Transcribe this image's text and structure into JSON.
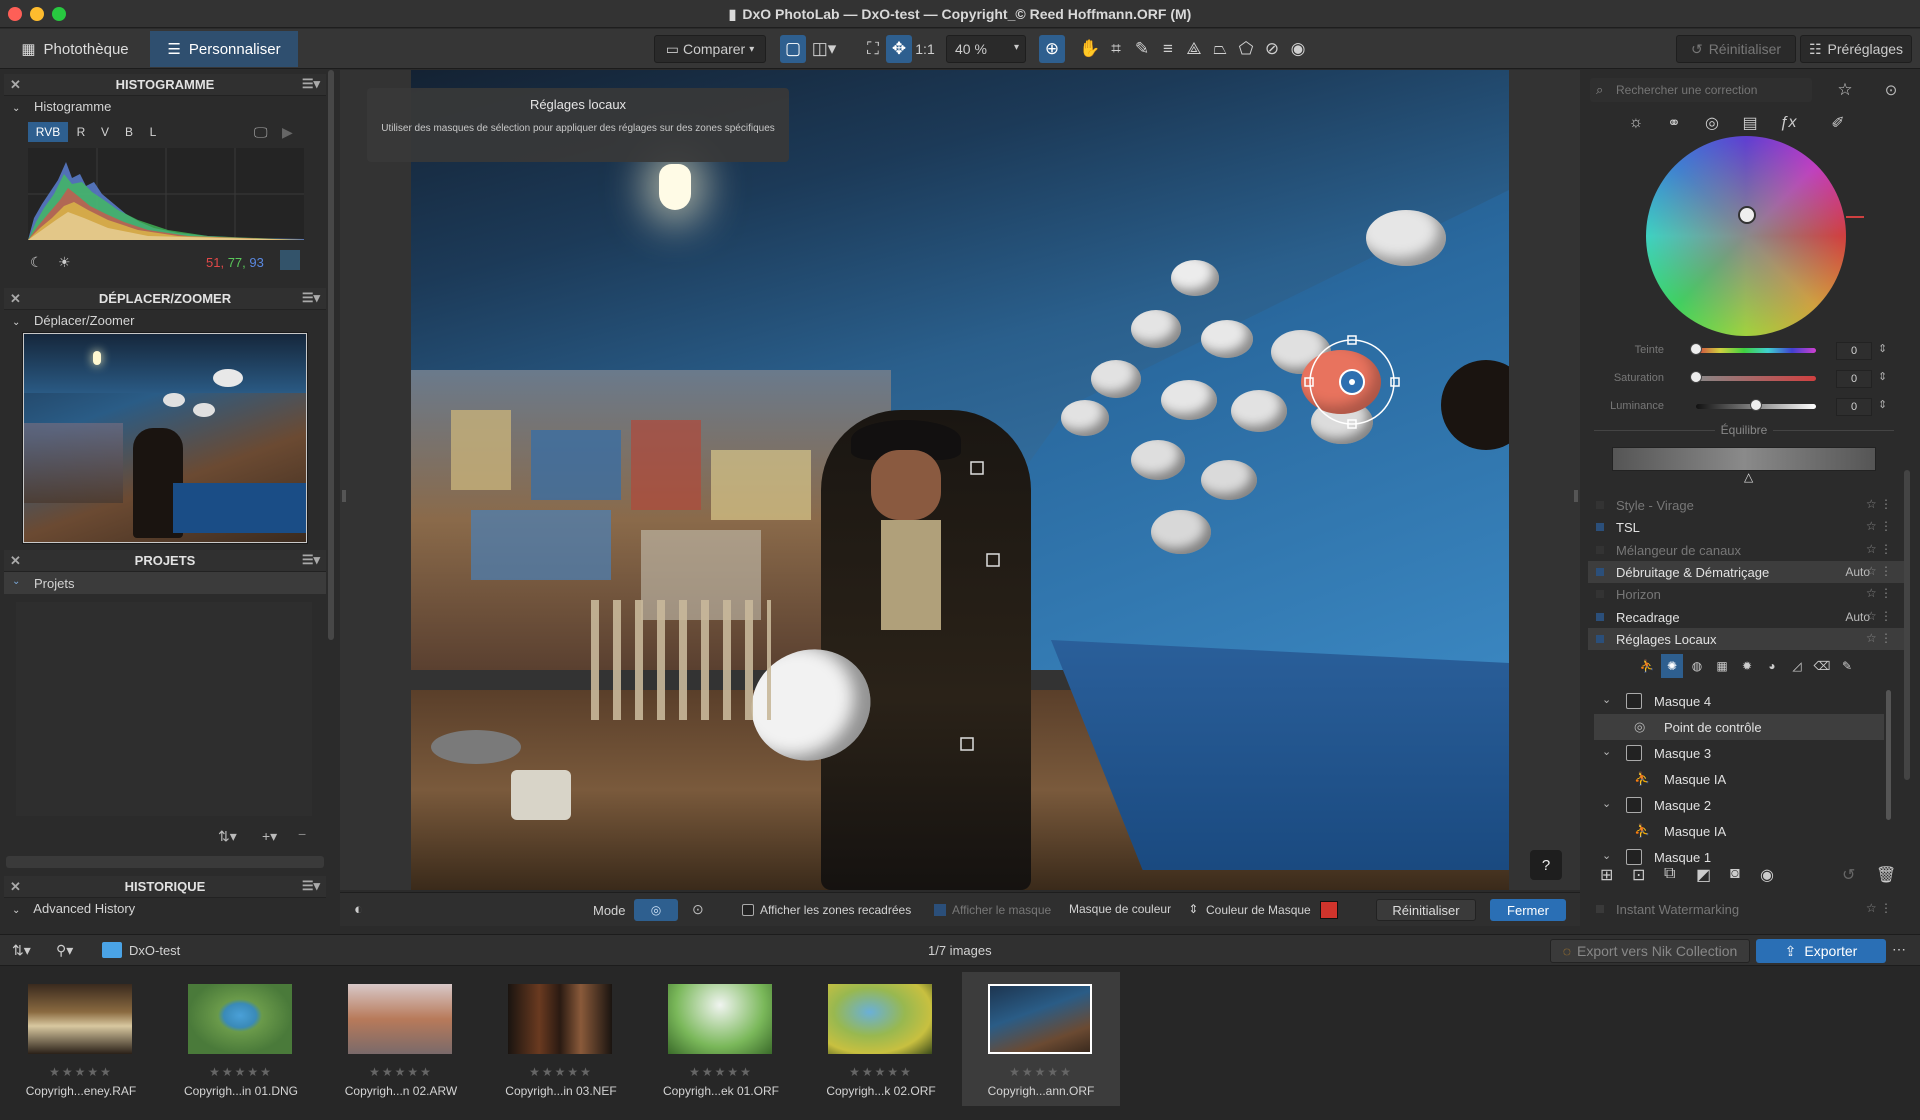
{
  "window": {
    "title": "DxO PhotoLab — DxO-test — Copyright_© Reed Hoffmann.ORF (M)"
  },
  "toolbar": {
    "tab_library": "Photothèque",
    "tab_customize": "Personnaliser",
    "compare_label": "Comparer",
    "one_to_one": "1:1",
    "zoom_value": "40 %",
    "reset_label": "Réinitialiser",
    "presets_label": "Préréglages"
  },
  "histogram_panel": {
    "header": "HISTOGRAMME",
    "sub_label": "Histogramme",
    "channels": [
      "RVB",
      "R",
      "V",
      "B",
      "L"
    ],
    "rgb_r": "51,",
    "rgb_g": "77,",
    "rgb_b": "93"
  },
  "move_zoom_panel": {
    "header": "DÉPLACER/ZOOMER",
    "sub_label": "Déplacer/Zoomer"
  },
  "projects_panel": {
    "header": "PROJETS",
    "sub_label": "Projets"
  },
  "history_panel": {
    "header": "HISTORIQUE",
    "sub_label": "Advanced History"
  },
  "tooltip": {
    "title": "Réglages locaux",
    "body": "Utiliser des masques de sélection pour appliquer des réglages sur des zones spécifiques"
  },
  "help_button": "?",
  "bottom_bar": {
    "mode_label": "Mode",
    "show_cropped": "Afficher les zones recadrées",
    "show_mask": "Afficher le masque",
    "mask_type": "Masque de couleur",
    "mask_color_label": "Couleur de Masque",
    "reset": "Réinitialiser",
    "close": "Fermer",
    "mask_color": "#d0342c"
  },
  "right_panel": {
    "search_placeholder": "Rechercher une correction",
    "sliders": [
      {
        "label": "Teinte",
        "value": "0",
        "level": 0
      },
      {
        "label": "Saturation",
        "value": "0",
        "level": 0
      },
      {
        "label": "Luminance",
        "value": "0",
        "level": 0.5
      }
    ],
    "balance_label": "Équilibre",
    "corrections": [
      {
        "label": "Style - Virage",
        "auto": "",
        "enabled": false
      },
      {
        "label": "TSL",
        "auto": "",
        "enabled": true
      },
      {
        "label": "Mélangeur de canaux",
        "auto": "",
        "enabled": false
      },
      {
        "label": "Débruitage & Dématriçage",
        "auto": "Auto",
        "enabled": true,
        "highlight": true
      },
      {
        "label": "Horizon",
        "auto": "",
        "enabled": false
      },
      {
        "label": "Recadrage",
        "auto": "Auto",
        "enabled": true
      },
      {
        "label": "Réglages Locaux",
        "auto": "",
        "enabled": true,
        "highlight": true
      }
    ],
    "masks": [
      {
        "label": "Masque 4",
        "child": "Point de contrôle"
      },
      {
        "label": "Masque 3",
        "child": "Masque IA"
      },
      {
        "label": "Masque 2",
        "child": "Masque IA"
      },
      {
        "label": "Masque 1"
      }
    ],
    "instant_watermarking": "Instant Watermarking"
  },
  "filmstrip_bar": {
    "folder": "DxO-test",
    "count": "1/7 images",
    "nik_export": "Export vers Nik Collection",
    "export": "Exporter"
  },
  "thumbnails": [
    {
      "name": "Copyrigh...eney.RAF",
      "stars": "★★★★★"
    },
    {
      "name": "Copyrigh...in 01.DNG",
      "stars": "★★★★★"
    },
    {
      "name": "Copyrigh...n 02.ARW",
      "stars": "★★★★★"
    },
    {
      "name": "Copyrigh...in 03.NEF",
      "stars": "★★★★★"
    },
    {
      "name": "Copyrigh...ek 01.ORF",
      "stars": "★★★★★"
    },
    {
      "name": "Copyrigh...k 02.ORF",
      "stars": "★★★★★"
    },
    {
      "name": "Copyrigh...ann.ORF",
      "stars": "★★★★★",
      "selected": true
    }
  ]
}
